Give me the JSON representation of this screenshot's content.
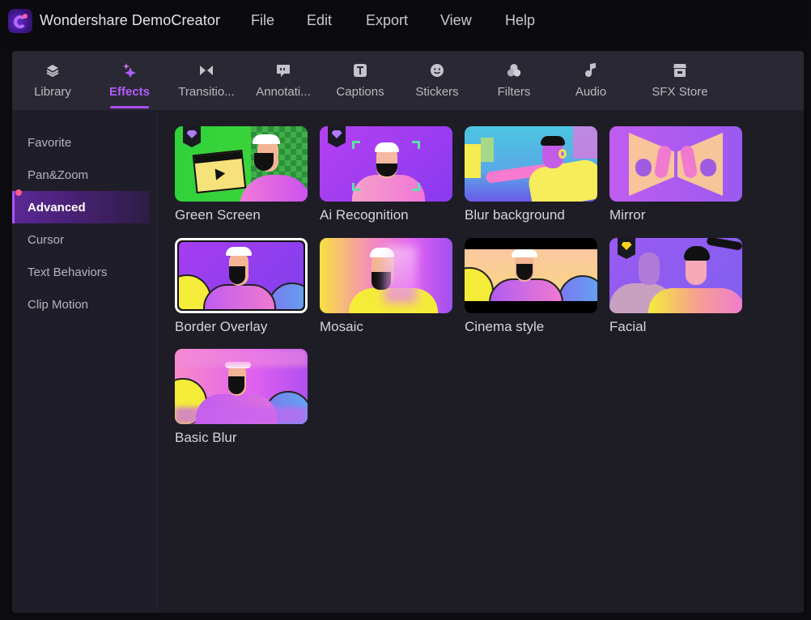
{
  "app": {
    "title": "Wondershare DemoCreator",
    "menu": [
      "File",
      "Edit",
      "Export",
      "View",
      "Help"
    ]
  },
  "tabs": [
    {
      "label": "Library",
      "icon": "layers-icon",
      "active": false
    },
    {
      "label": "Effects",
      "icon": "sparkles-icon",
      "active": true
    },
    {
      "label": "Transitio...",
      "icon": "transition-icon",
      "active": false
    },
    {
      "label": "Annotati...",
      "icon": "annotation-icon",
      "active": false
    },
    {
      "label": "Captions",
      "icon": "captions-icon",
      "active": false
    },
    {
      "label": "Stickers",
      "icon": "sticker-icon",
      "active": false
    },
    {
      "label": "Filters",
      "icon": "filters-icon",
      "active": false
    },
    {
      "label": "Audio",
      "icon": "music-note-icon",
      "active": false
    },
    {
      "label": "SFX Store",
      "icon": "store-icon",
      "active": false
    }
  ],
  "sidebar": {
    "items": [
      {
        "label": "Favorite",
        "active": false
      },
      {
        "label": "Pan&Zoom",
        "active": false
      },
      {
        "label": "Advanced",
        "active": true
      },
      {
        "label": "Cursor",
        "active": false
      },
      {
        "label": "Text Behaviors",
        "active": false
      },
      {
        "label": "Clip Motion",
        "active": false
      }
    ]
  },
  "effects": [
    {
      "label": "Green Screen",
      "badge": "premium-purple"
    },
    {
      "label": "Ai Recognition",
      "badge": "premium-purple"
    },
    {
      "label": "Blur background",
      "badge": null
    },
    {
      "label": "Mirror",
      "badge": null
    },
    {
      "label": "Border Overlay",
      "badge": null,
      "selected": true
    },
    {
      "label": "Mosaic",
      "badge": null
    },
    {
      "label": "Cinema style",
      "badge": null
    },
    {
      "label": "Facial",
      "badge": "premium-gold"
    },
    {
      "label": "Basic Blur",
      "badge": null
    }
  ],
  "colors": {
    "accent": "#a84ef5",
    "titlebar_bg": "#0b0b0d",
    "panel_bg": "#1f1e28",
    "tabbar_bg": "#2a2933"
  }
}
